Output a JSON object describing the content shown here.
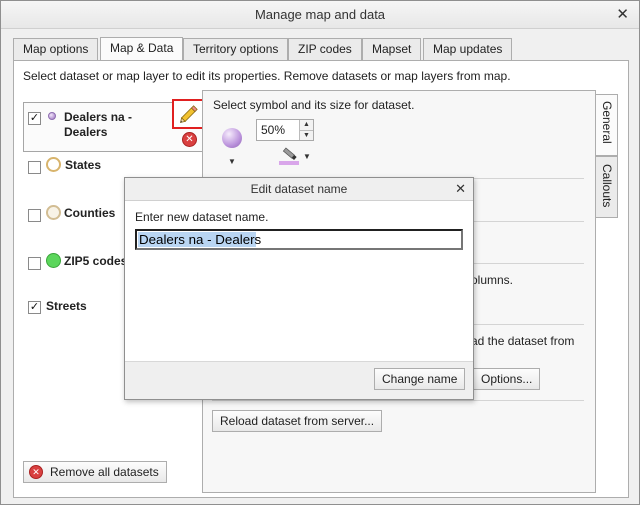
{
  "window": {
    "title": "Manage map and data",
    "close_glyph": "✕"
  },
  "tabs": [
    {
      "label": "Map options",
      "active": false
    },
    {
      "label": "Map & Data",
      "active": true
    },
    {
      "label": "Territory options",
      "active": false
    },
    {
      "label": "ZIP codes",
      "active": false
    },
    {
      "label": "Mapset",
      "active": false
    },
    {
      "label": "Map updates",
      "active": false
    }
  ],
  "instructions": "Select dataset or map layer to edit its properties. Remove datasets or map layers from map.",
  "layers": [
    {
      "name_line1": "Dealers na -",
      "name_line2": "Dealers",
      "checked": true,
      "icon": "purple-dot-icon"
    },
    {
      "name": "States",
      "checked": false,
      "icon": "orange-ring-icon"
    },
    {
      "name": "Counties",
      "checked": false,
      "icon": "tan-ring-icon"
    },
    {
      "name": "ZIP5 codes",
      "checked": false,
      "icon": "green-dot-icon"
    },
    {
      "name": "Streets",
      "checked": true,
      "icon": "none"
    }
  ],
  "checkmark": "✓",
  "remove_all_label": "Remove all datasets",
  "right_panel": {
    "vtabs": [
      {
        "label": "General",
        "active": true
      },
      {
        "label": "Callouts",
        "active": false
      }
    ],
    "symbol_prompt": "Select symbol and its size for dataset.",
    "size_value": "50%",
    "columns_fragment": "olumns.",
    "reload_fragment": "ad the dataset from",
    "options_label": "Options...",
    "reload_label": "Reload dataset from server..."
  },
  "dialog": {
    "title": "Edit dataset name",
    "close_glyph": "✕",
    "prompt": "Enter new dataset name.",
    "value": "Dealers na - Dealers",
    "change_label": "Change name"
  },
  "colors": {
    "accent_red": "#e02020",
    "selection": "#b9d5f2",
    "focus_border": "#3b8fd0"
  }
}
